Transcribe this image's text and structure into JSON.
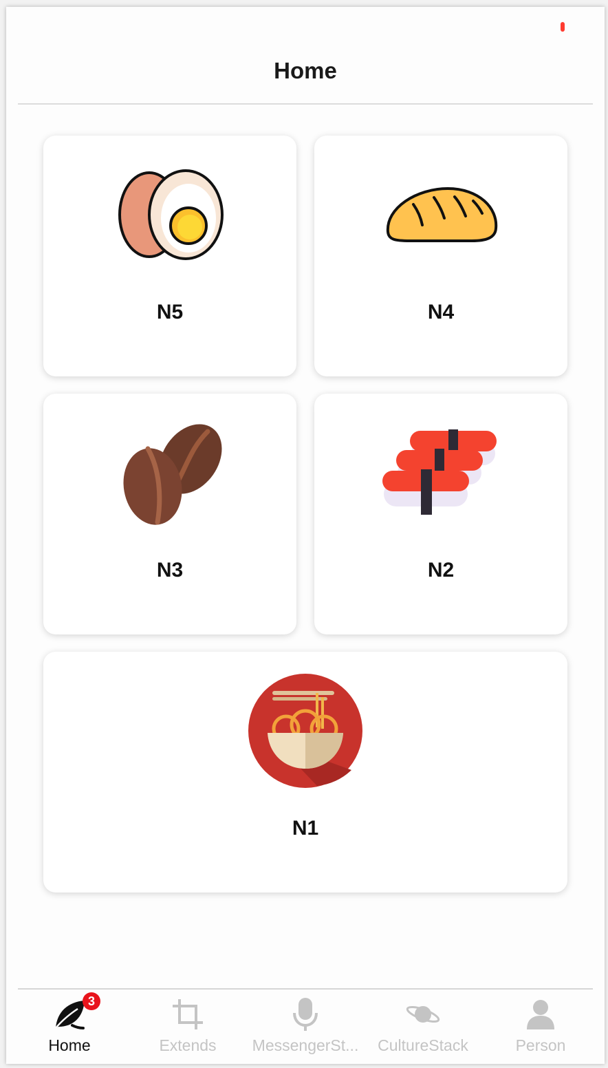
{
  "header": {
    "title": "Home"
  },
  "cards": [
    {
      "label": "N5",
      "icon": "egg-icon"
    },
    {
      "label": "N4",
      "icon": "bread-icon"
    },
    {
      "label": "N3",
      "icon": "coffee-beans-icon"
    },
    {
      "label": "N2",
      "icon": "sushi-icon"
    },
    {
      "label": "N1",
      "icon": "noodle-bowl-icon"
    }
  ],
  "tabbar": {
    "tabs": [
      {
        "label": "Home",
        "icon": "leaf-icon",
        "badge": "3",
        "active": true
      },
      {
        "label": "Extends",
        "icon": "crop-icon"
      },
      {
        "label": "MessengerSt...",
        "icon": "microphone-icon"
      },
      {
        "label": "CultureStack",
        "icon": "planet-icon"
      },
      {
        "label": "Person",
        "icon": "person-icon"
      }
    ]
  },
  "colors": {
    "accent": "#e8141c",
    "inactive_tab": "#c4c4c4",
    "active_tab": "#111111",
    "status_dot": "#ff3b30"
  }
}
